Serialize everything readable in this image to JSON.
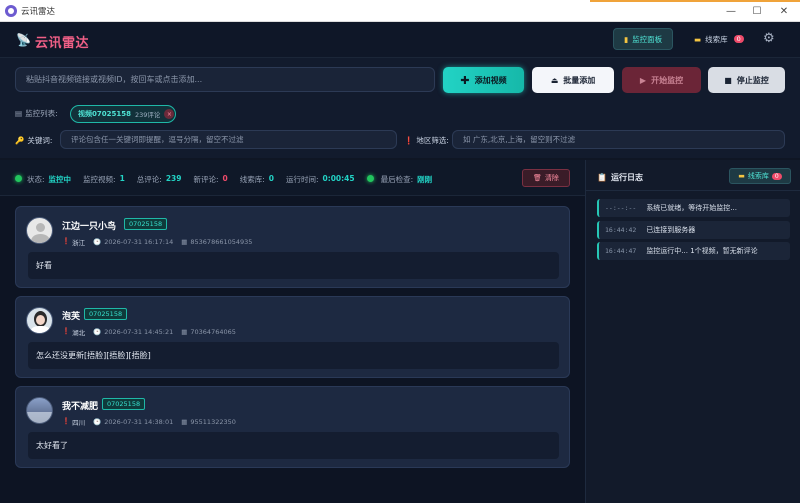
{
  "window": {
    "title": "云讯雷达",
    "minimize": "—",
    "maximize": "☐",
    "close": "✕"
  },
  "header": {
    "logo": "云讯雷达",
    "monitor_panel": "监控面板",
    "leads_library": "线索库",
    "leads_badge": "0"
  },
  "top": {
    "url_placeholder": "粘贴抖音视频链接或视频ID，按回车或点击添加...",
    "add_video": "添加视频",
    "batch_add": "批量添加",
    "start_monitor": "开始监控",
    "stop_monitor": "停止监控",
    "monitor_list_label": "监控列表:",
    "monitor_tag": {
      "video": "视频07025158",
      "count": "239评论"
    },
    "keyword_label": "关键词:",
    "keyword_placeholder": "评论包含任一关键词即提醒，逗号分隔，留空不过滤",
    "region_label": "地区筛选:",
    "region_placeholder": "如 广东,北京,上海，留空则不过滤"
  },
  "status": {
    "state_label": "状态:",
    "state_value": "监控中",
    "videos_label": "监控视频:",
    "videos_value": "1",
    "total_label": "总评论:",
    "total_value": "239",
    "new_label": "新评论:",
    "new_value": "0",
    "leads_label": "线索库:",
    "leads_value": "0",
    "runtime_label": "运行时间:",
    "runtime_value": "0:00:45",
    "last_check_label": "最后检查:",
    "last_check_value": "刚刚",
    "clear": "清除"
  },
  "comments": [
    {
      "name": "江边一只小鸟",
      "tag": "07025158",
      "region": "浙江",
      "time": "2026-07-31 16:17:14",
      "uid": "853678661054935",
      "text": "好看"
    },
    {
      "name": "泡芙",
      "tag": "07025158",
      "region": "湖北",
      "time": "2026-07-31 14:45:21",
      "uid": "70364764065",
      "text": "怎么还没更新[捂脸][捂脸][捂脸]"
    },
    {
      "name": "我不减肥",
      "tag": "07025158",
      "region": "四川",
      "time": "2026-07-31 14:38:01",
      "uid": "95511322350",
      "text": "太好看了"
    }
  ],
  "log": {
    "title": "运行日志",
    "leads_button": "线索库",
    "leads_badge": "0",
    "items": [
      {
        "time": "--:--:--",
        "msg": "系统已就绪，等待开始监控..."
      },
      {
        "time": "16:44:42",
        "msg": "已连接到服务器"
      },
      {
        "time": "16:44:47",
        "msg": "监控运行中... 1个视频，暂无新评论"
      }
    ]
  },
  "colors": {
    "accent": "#22d3c5",
    "brand": "#ef5f86",
    "danger": "#e04a62"
  }
}
